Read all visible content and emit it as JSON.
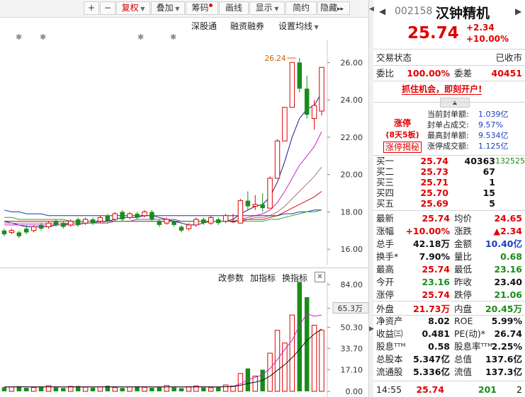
{
  "toolbar": {
    "plus": "+",
    "minus": "−",
    "fuquan": "复权",
    "diejia": "叠加",
    "choumai": "筹码",
    "huaxian": "画线",
    "xianshi": "显示",
    "jianyue": "简约",
    "yincang": "隐藏",
    "more": "▸▸"
  },
  "chart_links": {
    "shengu": "深股通",
    "rongzi": "融资融券",
    "junxian": "设置均线"
  },
  "volume_links": {
    "gaicanshu": "改参数",
    "jiazhibiao": "加指标",
    "huanzhibiao": "换指标",
    "close": "✕"
  },
  "chart_data": [
    {
      "type": "candlestick",
      "y_ticks": [
        "26.00",
        "24.00",
        "22.00",
        "20.00",
        "18.00",
        "16.00"
      ],
      "ylim": [
        15.4,
        27.0
      ],
      "high_annotation": "26.24",
      "candles": [
        {
          "o": 17.0,
          "c": 16.8,
          "h": 17.1,
          "l": 16.7
        },
        {
          "o": 16.9,
          "c": 17.0,
          "h": 17.1,
          "l": 16.8
        },
        {
          "o": 16.9,
          "c": 16.7,
          "h": 17.0,
          "l": 16.6
        },
        {
          "o": 17.1,
          "c": 16.9,
          "h": 17.3,
          "l": 16.8
        },
        {
          "o": 17.0,
          "c": 17.2,
          "h": 17.3,
          "l": 16.9
        },
        {
          "o": 17.3,
          "c": 17.1,
          "h": 17.4,
          "l": 17.0
        },
        {
          "o": 17.2,
          "c": 17.4,
          "h": 17.5,
          "l": 17.1
        },
        {
          "o": 17.5,
          "c": 17.3,
          "h": 17.6,
          "l": 17.2
        },
        {
          "o": 17.4,
          "c": 17.2,
          "h": 17.5,
          "l": 17.1
        },
        {
          "o": 17.3,
          "c": 17.5,
          "h": 17.6,
          "l": 17.2
        },
        {
          "o": 17.6,
          "c": 17.3,
          "h": 17.7,
          "l": 17.2
        },
        {
          "o": 17.4,
          "c": 17.6,
          "h": 17.7,
          "l": 17.3
        },
        {
          "o": 17.6,
          "c": 17.4,
          "h": 17.7,
          "l": 17.3
        },
        {
          "o": 17.5,
          "c": 17.7,
          "h": 17.8,
          "l": 17.4
        },
        {
          "o": 17.8,
          "c": 17.5,
          "h": 17.9,
          "l": 17.4
        },
        {
          "o": 17.6,
          "c": 17.9,
          "h": 18.0,
          "l": 17.5
        },
        {
          "o": 18.0,
          "c": 17.6,
          "h": 18.1,
          "l": 17.5
        },
        {
          "o": 17.7,
          "c": 17.9,
          "h": 18.0,
          "l": 17.6
        },
        {
          "o": 17.9,
          "c": 17.7,
          "h": 18.0,
          "l": 17.6
        },
        {
          "o": 17.8,
          "c": 18.0,
          "h": 18.1,
          "l": 17.7
        },
        {
          "o": 18.0,
          "c": 17.6,
          "h": 18.1,
          "l": 17.5
        },
        {
          "o": 17.5,
          "c": 17.3,
          "h": 17.6,
          "l": 17.2
        },
        {
          "o": 17.4,
          "c": 17.6,
          "h": 17.7,
          "l": 17.3
        },
        {
          "o": 17.5,
          "c": 17.3,
          "h": 17.6,
          "l": 17.2
        },
        {
          "o": 17.2,
          "c": 17.0,
          "h": 17.3,
          "l": 16.9
        },
        {
          "o": 17.1,
          "c": 17.3,
          "h": 17.4,
          "l": 17.0
        },
        {
          "o": 17.3,
          "c": 17.6,
          "h": 17.7,
          "l": 17.2
        },
        {
          "o": 17.6,
          "c": 17.4,
          "h": 17.7,
          "l": 17.3
        },
        {
          "o": 17.4,
          "c": 17.7,
          "h": 17.8,
          "l": 17.3
        },
        {
          "o": 17.6,
          "c": 17.4,
          "h": 17.7,
          "l": 17.3
        },
        {
          "o": 17.5,
          "c": 17.8,
          "h": 17.9,
          "l": 17.4
        },
        {
          "o": 17.5,
          "c": 17.5,
          "h": 17.9,
          "l": 17.4
        },
        {
          "o": 17.4,
          "c": 18.6,
          "h": 18.7,
          "l": 17.4
        },
        {
          "o": 18.6,
          "c": 18.3,
          "h": 19.1,
          "l": 18.1
        },
        {
          "o": 18.3,
          "c": 18.4,
          "h": 18.9,
          "l": 18.1
        },
        {
          "o": 18.4,
          "c": 18.2,
          "h": 19.0,
          "l": 18.0
        },
        {
          "o": 18.2,
          "c": 19.8,
          "h": 19.9,
          "l": 18.2
        },
        {
          "o": 19.8,
          "c": 21.8,
          "h": 21.9,
          "l": 19.8
        },
        {
          "o": 21.8,
          "c": 23.6,
          "h": 23.6,
          "l": 21.8
        },
        {
          "o": 23.6,
          "c": 26.0,
          "h": 26.0,
          "l": 23.6
        },
        {
          "o": 26.0,
          "c": 24.6,
          "h": 26.24,
          "l": 24.4
        },
        {
          "o": 24.6,
          "c": 23.2,
          "h": 25.3,
          "l": 23.0
        },
        {
          "o": 23.0,
          "c": 23.7,
          "h": 24.0,
          "l": 22.4
        },
        {
          "o": 23.4,
          "c": 25.74,
          "h": 25.74,
          "l": 23.16
        }
      ],
      "ma_series": [
        {
          "color": "#1a1a8c",
          "values": [
            17.5,
            17.4,
            17.3,
            17.2,
            17.2,
            17.2,
            17.2,
            17.3,
            17.3,
            17.4,
            17.4,
            17.4,
            17.4,
            17.5,
            17.5,
            17.6,
            17.7,
            17.7,
            17.7,
            17.8,
            17.8,
            17.7,
            17.6,
            17.5,
            17.4,
            17.3,
            17.3,
            17.4,
            17.5,
            17.5,
            17.5,
            17.6,
            17.9,
            18.1,
            18.3,
            18.4,
            18.8,
            19.6,
            20.7,
            22.0,
            23.0,
            23.5,
            23.7,
            24.4
          ]
        },
        {
          "color": "#cc22cc",
          "values": [
            17.3,
            17.3,
            17.3,
            17.3,
            17.3,
            17.3,
            17.3,
            17.3,
            17.3,
            17.3,
            17.3,
            17.4,
            17.4,
            17.4,
            17.4,
            17.5,
            17.5,
            17.5,
            17.6,
            17.6,
            17.6,
            17.6,
            17.6,
            17.6,
            17.5,
            17.5,
            17.5,
            17.5,
            17.5,
            17.5,
            17.5,
            17.5,
            17.6,
            17.7,
            17.8,
            17.9,
            18.1,
            18.5,
            19.1,
            19.8,
            20.5,
            21.0,
            21.5,
            22.3
          ]
        },
        {
          "color": "#aa7777",
          "values": [
            17.4,
            17.4,
            17.4,
            17.4,
            17.4,
            17.4,
            17.4,
            17.4,
            17.4,
            17.4,
            17.4,
            17.4,
            17.4,
            17.4,
            17.5,
            17.5,
            17.5,
            17.5,
            17.5,
            17.5,
            17.5,
            17.5,
            17.5,
            17.5,
            17.5,
            17.5,
            17.5,
            17.5,
            17.5,
            17.5,
            17.5,
            17.5,
            17.6,
            17.6,
            17.7,
            17.7,
            17.8,
            18.0,
            18.3,
            18.7,
            19.1,
            19.5,
            19.9,
            20.4
          ]
        },
        {
          "color": "#cc1111",
          "values": [
            17.5,
            17.5,
            17.5,
            17.5,
            17.5,
            17.5,
            17.5,
            17.5,
            17.5,
            17.5,
            17.5,
            17.5,
            17.5,
            17.5,
            17.5,
            17.5,
            17.5,
            17.5,
            17.5,
            17.5,
            17.5,
            17.5,
            17.5,
            17.5,
            17.5,
            17.5,
            17.5,
            17.5,
            17.5,
            17.5,
            17.5,
            17.5,
            17.5,
            17.6,
            17.6,
            17.6,
            17.7,
            17.8,
            18.0,
            18.2,
            18.4,
            18.6,
            18.8,
            19.1
          ]
        },
        {
          "color": "#2233aa",
          "values": [
            18.1,
            18.0,
            18.0,
            17.9,
            17.9,
            17.9,
            17.8,
            17.8,
            17.8,
            17.8,
            17.8,
            17.8,
            17.8,
            17.8,
            17.8,
            17.8,
            17.8,
            17.8,
            17.8,
            17.8,
            17.8,
            17.8,
            17.8,
            17.8,
            17.8,
            17.8,
            17.8,
            17.8,
            17.8,
            17.8,
            17.8,
            17.8,
            17.8,
            17.8,
            17.8,
            17.8,
            17.8,
            17.8,
            17.9,
            17.9,
            18.0,
            18.0,
            18.1,
            18.1
          ]
        },
        {
          "color": "#22aa22",
          "values": [
            17.7,
            17.7,
            17.6,
            17.6,
            17.6,
            17.6,
            17.6,
            17.6,
            17.6,
            17.5,
            17.5,
            17.5,
            17.5,
            17.5,
            17.5,
            17.5,
            17.5,
            17.5,
            17.5,
            17.5,
            17.5,
            17.5,
            17.5,
            17.5,
            17.5,
            17.5,
            17.5,
            17.5,
            17.5,
            17.5,
            17.5,
            17.5,
            17.5,
            17.5,
            17.5,
            17.5,
            17.6,
            17.6,
            17.7,
            17.8,
            17.9,
            18.0,
            18.0,
            18.1
          ]
        }
      ]
    },
    {
      "type": "bar",
      "y_ticks": [
        "84.00",
        "65.3万",
        "50.30",
        "33.70",
        "17.10",
        "0.00"
      ],
      "ylim": [
        0,
        84
      ],
      "volumes": [
        3.2,
        3.5,
        4.1,
        2.8,
        3.0,
        3.8,
        4.5,
        3.1,
        2.6,
        3.9,
        4.2,
        3.3,
        2.9,
        3.6,
        4.4,
        3.0,
        2.7,
        3.5,
        4.0,
        3.2,
        2.8,
        3.4,
        4.6,
        3.1,
        2.5,
        3.7,
        4.3,
        3.0,
        2.9,
        3.6,
        5.0,
        4.2,
        14.0,
        18.0,
        12.0,
        17.0,
        30.0,
        48.0,
        38.0,
        60.0,
        86.0,
        74.0,
        52.0,
        48.0
      ],
      "ma_series": [
        {
          "color": "#cc22cc",
          "values": [
            3.5,
            3.5,
            3.6,
            3.6,
            3.5,
            3.5,
            3.6,
            3.6,
            3.5,
            3.5,
            3.6,
            3.6,
            3.5,
            3.5,
            3.6,
            3.6,
            3.5,
            3.5,
            3.6,
            3.6,
            3.5,
            3.5,
            3.6,
            3.6,
            3.5,
            3.5,
            3.6,
            3.6,
            3.5,
            3.5,
            3.7,
            3.9,
            6.0,
            9.0,
            11.0,
            13.0,
            18.0,
            25.0,
            33.0,
            40.0,
            52.0,
            61.0,
            59.0,
            60.0
          ]
        },
        {
          "color": "#111111",
          "values": [
            3.5,
            3.5,
            3.5,
            3.5,
            3.5,
            3.5,
            3.5,
            3.5,
            3.5,
            3.5,
            3.5,
            3.5,
            3.5,
            3.5,
            3.5,
            3.5,
            3.5,
            3.5,
            3.5,
            3.5,
            3.5,
            3.5,
            3.5,
            3.5,
            3.5,
            3.5,
            3.5,
            3.5,
            3.5,
            3.5,
            3.6,
            3.7,
            4.8,
            6.2,
            7.2,
            8.8,
            12.0,
            16.5,
            21.0,
            26.5,
            33.0,
            40.0,
            45.0,
            49.0
          ]
        }
      ]
    }
  ],
  "stock": {
    "code": "002158",
    "name": "汉钟精机",
    "price": "25.74",
    "change": "+2.34",
    "change_pct": "+10.00%",
    "status_label": "交易状态",
    "status_value": "已收市",
    "weibi_label": "委比",
    "weibi_value": "100.00%",
    "weicha_label": "委差",
    "weicha_value": "40451",
    "promo": "抓住机会，即刻开户!",
    "zt_title": "涨停",
    "zt_days": "(8天5板)",
    "zt_btn": "涨停揭秘",
    "zt_info": [
      {
        "label": "当前封单额:",
        "value": "1.039亿"
      },
      {
        "label": "封单占成交:",
        "value": "9.57%"
      },
      {
        "label": "最高封单额:",
        "value": "9.534亿"
      },
      {
        "label": "涨停成交额:",
        "value": "1.125亿"
      }
    ],
    "bids": [
      {
        "label": "买一",
        "price": "25.74",
        "vol": "40363",
        "extra": "132525"
      },
      {
        "label": "买二",
        "price": "25.73",
        "vol": "67"
      },
      {
        "label": "买三",
        "price": "25.71",
        "vol": "1"
      },
      {
        "label": "买四",
        "price": "25.70",
        "vol": "15"
      },
      {
        "label": "买五",
        "price": "25.69",
        "vol": "5"
      }
    ],
    "stats": [
      {
        "l1": "最新",
        "v1": "25.74",
        "c1": "r",
        "l2": "均价",
        "v2": "24.65",
        "c2": "r"
      },
      {
        "l1": "涨幅",
        "v1": "+10.00%",
        "c1": "r",
        "l2": "涨跌",
        "v2": "▲2.34",
        "c2": "r"
      },
      {
        "l1": "总手",
        "v1": "42.18万",
        "c1": "k",
        "l2": "金额",
        "v2": "10.40亿",
        "c2": "b"
      },
      {
        "l1": "换手*",
        "v1": "7.90%",
        "c1": "k",
        "l2": "量比",
        "v2": "0.68",
        "c2": "g"
      },
      {
        "l1": "最高",
        "v1": "25.74",
        "c1": "r",
        "l2": "最低",
        "v2": "23.16",
        "c2": "g"
      },
      {
        "l1": "今开",
        "v1": "23.16",
        "c1": "g",
        "l2": "昨收",
        "v2": "23.40",
        "c2": "k"
      },
      {
        "l1": "涨停",
        "v1": "25.74",
        "c1": "r",
        "l2": "跌停",
        "v2": "21.06",
        "c2": "g"
      },
      {
        "l1": "外盘",
        "v1": "21.73万",
        "c1": "r",
        "l2": "内盘",
        "v2": "20.45万",
        "c2": "g"
      },
      {
        "l1": "净资产",
        "v1": "8.02",
        "c1": "k",
        "l2": "ROE",
        "v2": "5.99%",
        "c2": "k"
      },
      {
        "l1": "收益㈢",
        "v1": "0.481",
        "c1": "k",
        "l2": "PE(动)*",
        "v2": "26.74",
        "c2": "k"
      },
      {
        "l1": "股息ᵀᵀᴹ",
        "v1": "0.58",
        "c1": "k",
        "l2": "股息率ᵀᵀᴹ",
        "v2": "2.25%",
        "c2": "k"
      },
      {
        "l1": "总股本",
        "v1": "5.347亿",
        "c1": "k",
        "l2": "总值",
        "v2": "137.6亿",
        "c2": "k"
      },
      {
        "l1": "流通股",
        "v1": "5.336亿",
        "c1": "k",
        "l2": "流值",
        "v2": "137.3亿",
        "c2": "k"
      }
    ],
    "tick": {
      "time": "14:55",
      "price": "25.74",
      "vol": "201",
      "num": "2"
    }
  }
}
